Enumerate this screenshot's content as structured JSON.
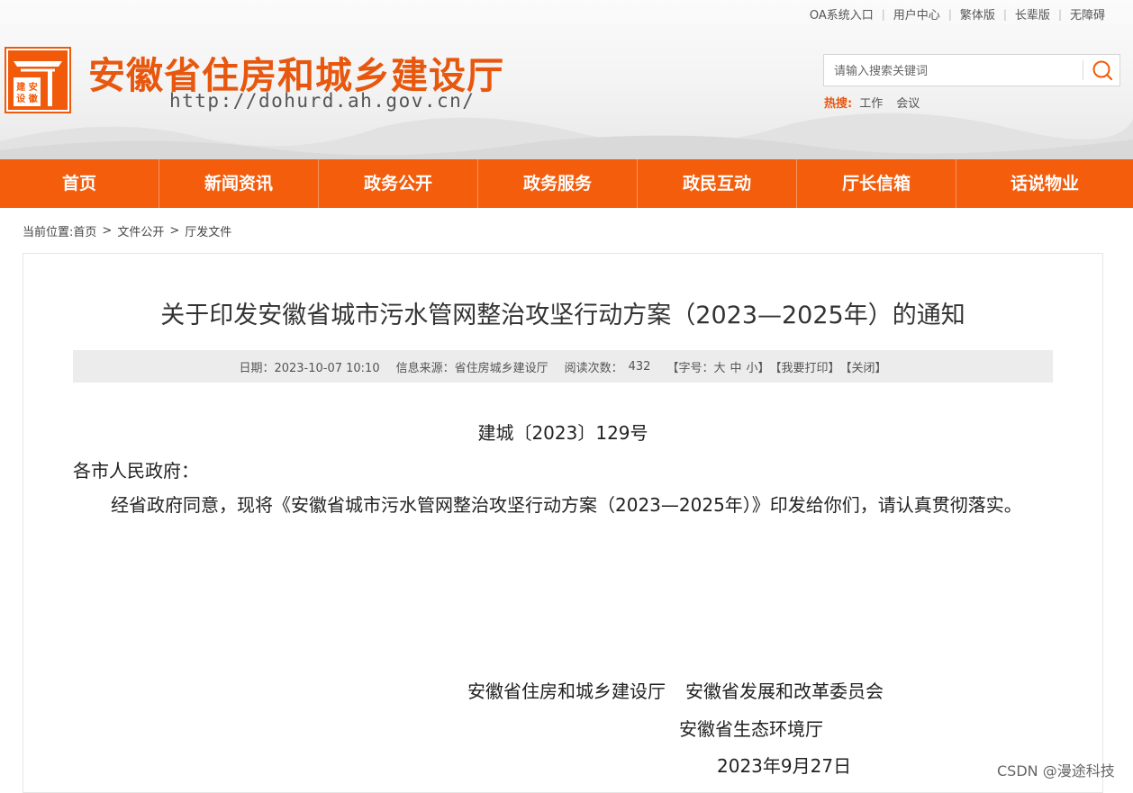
{
  "header": {
    "top_links": [
      "OA系统入口",
      "用户中心",
      "繁体版",
      "长辈版",
      "无障碍"
    ],
    "site_title": "安徽省住房和城乡建设厅",
    "site_url": "http://dohurd.ah.gov.cn/",
    "logo_text": "建设安徽",
    "search": {
      "placeholder": "请输入搜索关键词",
      "value": ""
    },
    "hot": {
      "label": "热搜:",
      "items": [
        "工作",
        "会议"
      ]
    }
  },
  "nav": {
    "items": [
      "首页",
      "新闻资讯",
      "政务公开",
      "政务服务",
      "政民互动",
      "厅长信箱",
      "话说物业"
    ]
  },
  "breadcrumb": {
    "label": "当前位置:",
    "items": [
      "首页",
      "文件公开",
      "厅发文件"
    ],
    "separator": ">"
  },
  "article": {
    "title": "关于印发安徽省城市污水管网整治攻坚行动方案（2023—2025年）的通知",
    "meta": {
      "date": "日期：2023-10-07 10:10",
      "source": "信息来源：省住房城乡建设厅",
      "views_label": "阅读次数：",
      "views": "432",
      "font_label": "【字号：",
      "font_large": "大",
      "font_medium": "中",
      "font_small": "小】",
      "print": "【我要打印】",
      "close": "【关闭】"
    },
    "doc_number": "建城〔2023〕129号",
    "salutation": "各市人民政府：",
    "body": "经省政府同意，现将《安徽省城市污水管网整治攻坚行动方案（2023—2025年）》印发给你们，请认真贯彻落实。",
    "signatories": [
      "安徽省住房和城乡建设厅",
      "安徽省发展和改革委员会",
      "安徽省生态环境厅"
    ],
    "sign_date": "2023年9月27日"
  },
  "watermark": "CSDN @漫途科技",
  "colors": {
    "brand": "#f35d0c",
    "title": "#e8570e"
  }
}
